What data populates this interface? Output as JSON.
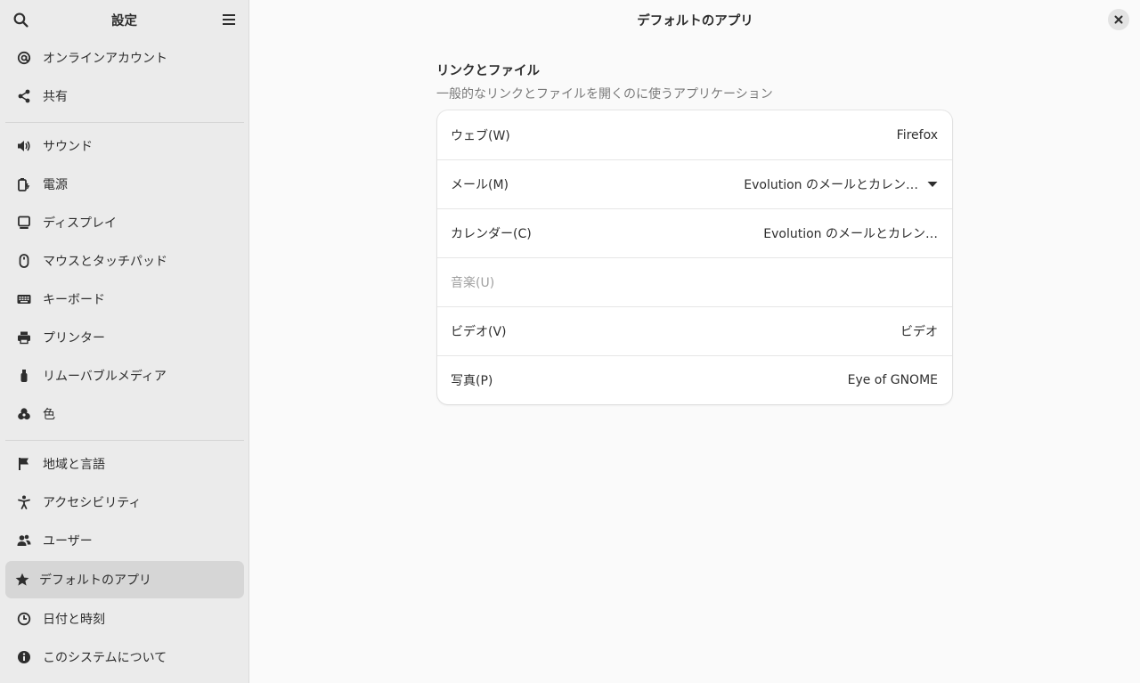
{
  "sidebar": {
    "title": "設定",
    "items": [
      {
        "label": "オンラインアカウント",
        "icon": "at-icon"
      },
      {
        "label": "共有",
        "icon": "share-icon"
      },
      {
        "label": "サウンド",
        "icon": "speaker-icon"
      },
      {
        "label": "電源",
        "icon": "power-icon"
      },
      {
        "label": "ディスプレイ",
        "icon": "display-icon"
      },
      {
        "label": "マウスとタッチパッド",
        "icon": "mouse-icon"
      },
      {
        "label": "キーボード",
        "icon": "keyboard-icon"
      },
      {
        "label": "プリンター",
        "icon": "printer-icon"
      },
      {
        "label": "リムーバブルメディア",
        "icon": "usb-icon"
      },
      {
        "label": "色",
        "icon": "color-icon"
      },
      {
        "label": "地域と言語",
        "icon": "flag-icon"
      },
      {
        "label": "アクセシビリティ",
        "icon": "accessibility-icon"
      },
      {
        "label": "ユーザー",
        "icon": "users-icon"
      },
      {
        "label": "デフォルトのアプリ",
        "icon": "star-icon",
        "active": true
      },
      {
        "label": "日付と時刻",
        "icon": "clock-icon"
      },
      {
        "label": "このシステムについて",
        "icon": "info-icon"
      }
    ]
  },
  "main": {
    "title": "デフォルトのアプリ",
    "section_title": "リンクとファイル",
    "section_subtitle": "一般的なリンクとファイルを開くのに使うアプリケーション",
    "rows": [
      {
        "label": "ウェブ(W)",
        "value": "Firefox"
      },
      {
        "label": "メール(M)",
        "value": "Evolution のメールとカレン…",
        "dropdown": true
      },
      {
        "label": "カレンダー(C)",
        "value": "Evolution のメールとカレン…"
      },
      {
        "label": "音楽(U)",
        "value": "",
        "disabled": true
      },
      {
        "label": "ビデオ(V)",
        "value": "ビデオ"
      },
      {
        "label": "写真(P)",
        "value": "Eye of GNOME"
      }
    ]
  },
  "colors": {
    "sidebar_bg": "#ebebeb",
    "active_item_bg": "#d6d6d6",
    "content_bg": "#fafafa",
    "card_bg": "#ffffff"
  }
}
